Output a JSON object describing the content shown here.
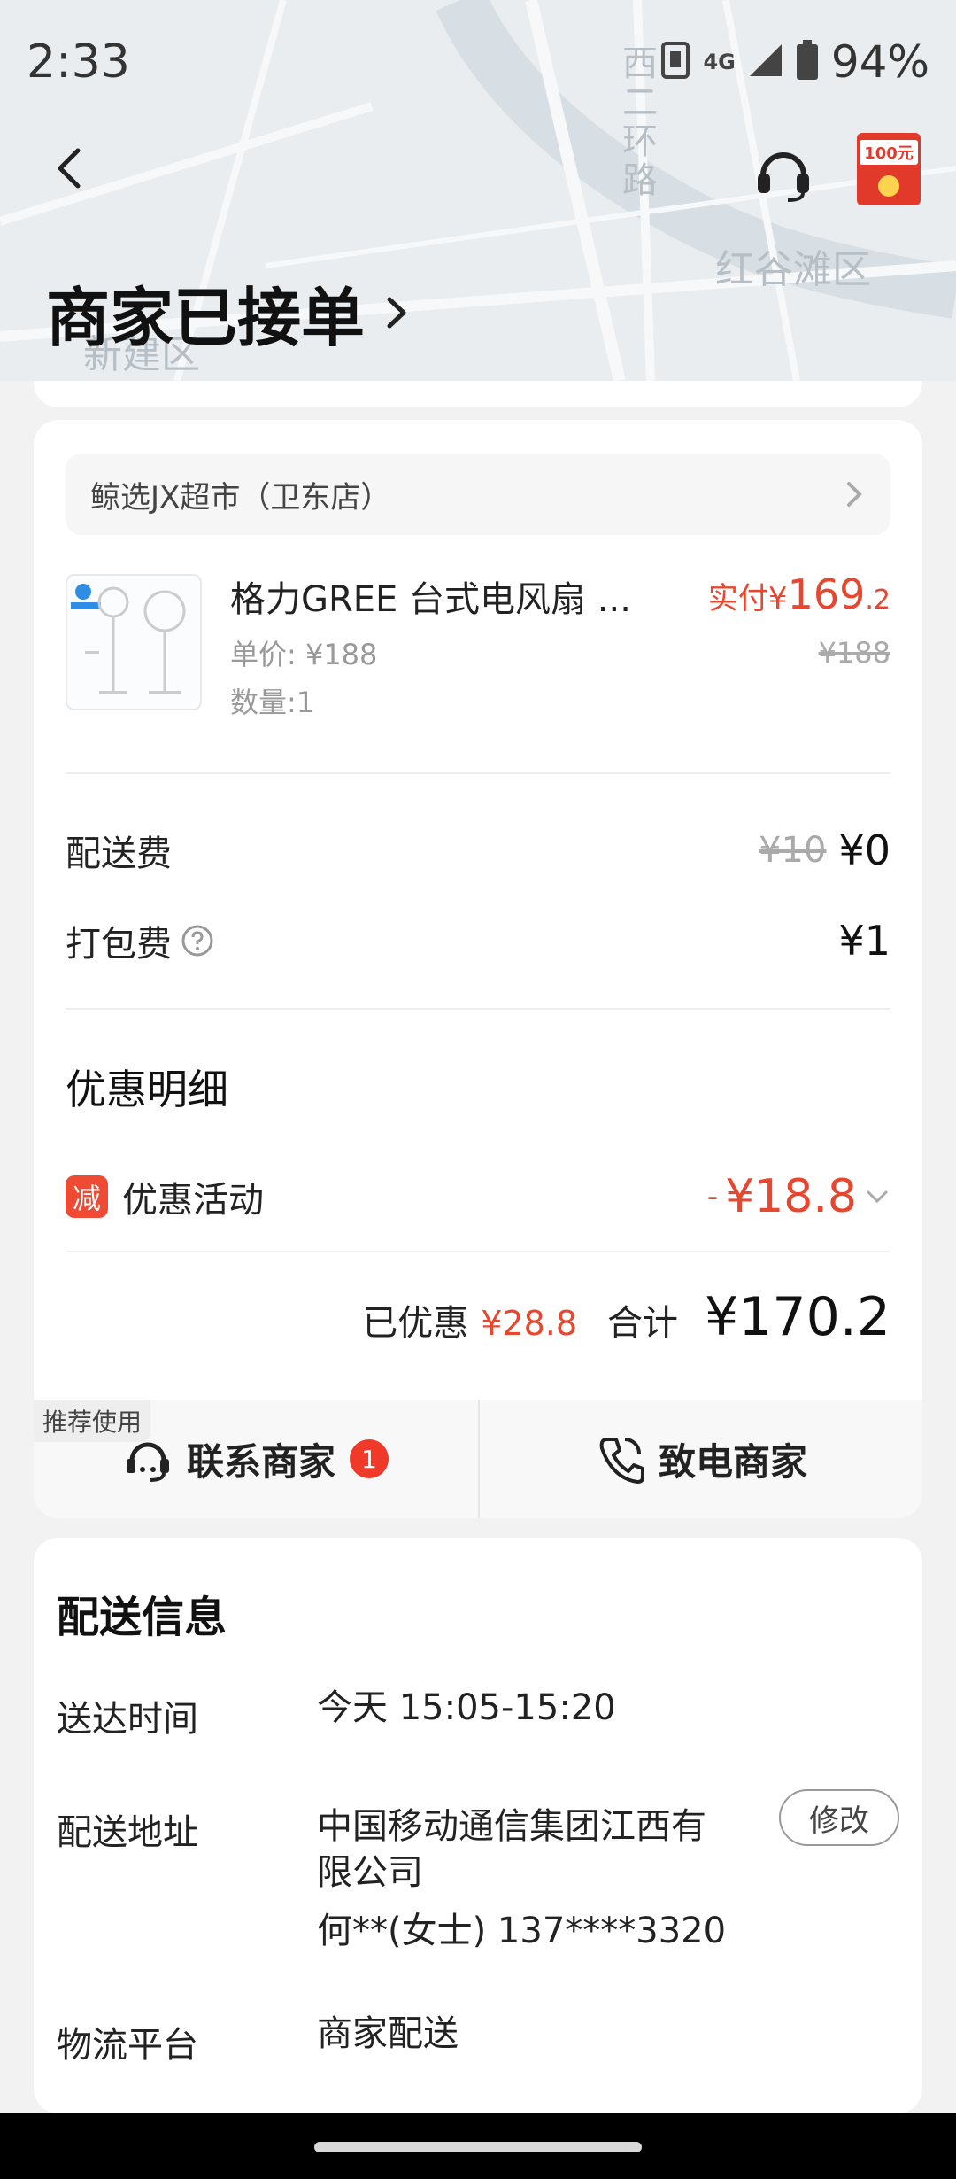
{
  "status_bar": {
    "time": "2:33",
    "battery": "94%",
    "network": "4G"
  },
  "map_labels": {
    "road": "西二环路",
    "district_1": "红谷滩区",
    "district_2": "新建区"
  },
  "header": {
    "order_status": "商家已接单"
  },
  "coupon": {
    "amount": "100元"
  },
  "shop": {
    "name": "鲸选JX超市（卫东店）"
  },
  "product": {
    "name": "格力GREE 台式电风扇 ...",
    "unit_price": "单价: ¥188",
    "quantity": "数量:1",
    "paid_prefix": "实付¥",
    "paid_int": "169",
    "paid_dec": ".2",
    "original_price": "¥188"
  },
  "fees": {
    "delivery_label": "配送费",
    "delivery_original": "¥10",
    "delivery_value": "¥0",
    "packing_label": "打包费",
    "packing_value": "¥1"
  },
  "discount": {
    "title": "优惠明细",
    "badge": "减",
    "label": "优惠活动",
    "minus": "-",
    "amount": "¥18.8"
  },
  "totals": {
    "saved_label": "已优惠",
    "saved_amount": "¥28.8",
    "total_label": "合计",
    "total_amount": "¥170.2"
  },
  "contact": {
    "recommend_tag": "推荐使用",
    "chat_label": "联系商家",
    "chat_badge": "1",
    "call_label": "致电商家"
  },
  "delivery": {
    "title": "配送信息",
    "time_label": "送达时间",
    "time_value": "今天 15:05-15:20",
    "address_label": "配送地址",
    "address_line1": "中国移动通信集团江西有",
    "address_line2": "限公司",
    "address_contact": "何**(女士) 137****3320",
    "edit_label": "修改",
    "platform_label": "物流平台",
    "platform_value": "商家配送"
  },
  "colors": {
    "accent_red": "#e8472f",
    "background": "#f2f2f2",
    "card": "#ffffff"
  }
}
